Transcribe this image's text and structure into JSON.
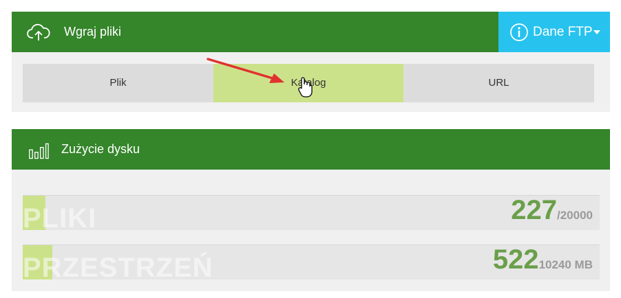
{
  "upload": {
    "title": "Wgraj pliki",
    "ftp_button": "Dane FTP",
    "tabs": [
      {
        "label": "Plik",
        "active": false
      },
      {
        "label": "Katalog",
        "active": true
      },
      {
        "label": "URL",
        "active": false
      }
    ]
  },
  "disk": {
    "title": "Zużycie dysku",
    "stats": [
      {
        "label": "PLIKI",
        "value": "227",
        "max": "/20000",
        "fill_fraction": 0.0114
      },
      {
        "label": "PRZESTRZEŃ",
        "value": "522",
        "max": "10240 MB",
        "fill_fraction": 0.051
      }
    ]
  },
  "colors": {
    "header_green": "#35852b",
    "ftp_blue": "#27c3ee",
    "active_tab": "#cce28a",
    "value_green": "#6a9f4a"
  },
  "icons": {
    "upload": "cloud-upload-icon",
    "ftp": "info-icon",
    "disk": "bar-chart-icon"
  }
}
